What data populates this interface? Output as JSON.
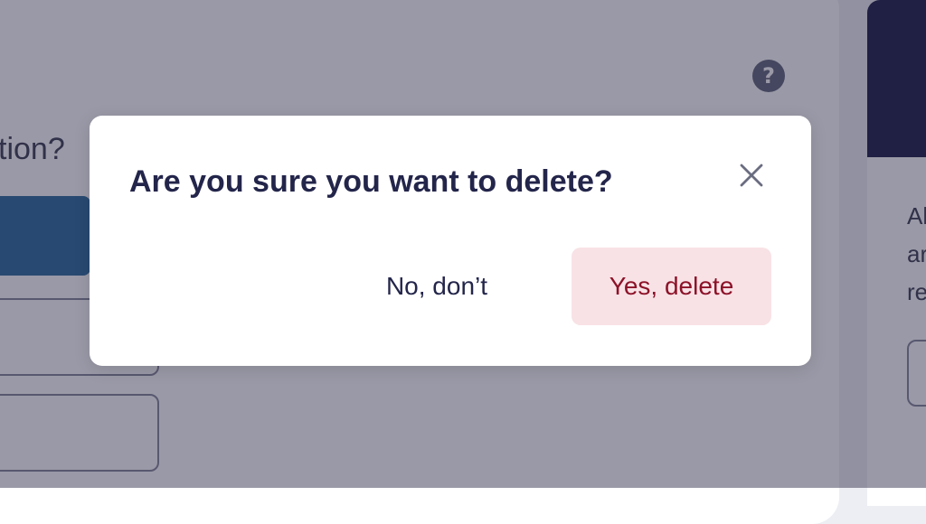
{
  "background": {
    "question_fragment": "tion?",
    "help_icon": {
      "glyph": "?",
      "icon": "help-circle-icon"
    },
    "right_panel_lines": [
      "Al",
      "ar",
      "re"
    ]
  },
  "modal": {
    "title": "Are you sure you want to delete?",
    "close_icon": "close-icon",
    "cancel_label": "No, don’t",
    "confirm_label": "Yes, delete"
  },
  "colors": {
    "overlay": "rgba(54,52,80,0.5)",
    "title_text": "#23254a",
    "danger_text": "#8c1228",
    "danger_bg": "#f8e2e6"
  }
}
